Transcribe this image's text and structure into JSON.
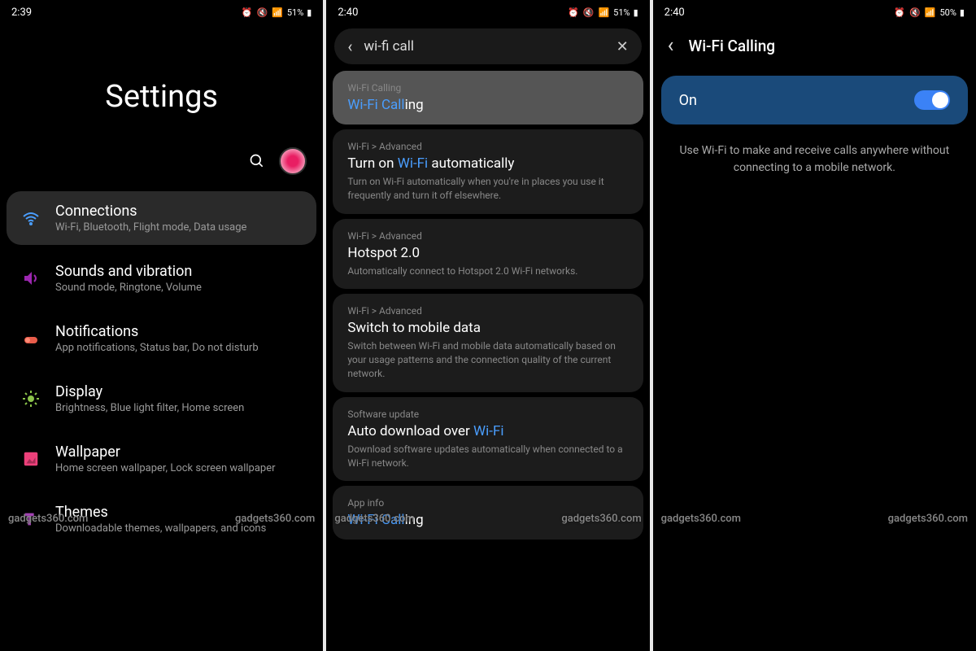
{
  "watermark": "gadgets360.com",
  "screens": [
    {
      "statusbar": {
        "time": "2:39",
        "battery": "51%"
      },
      "hero_title": "Settings",
      "items": [
        {
          "title": "Connections",
          "sub": "Wi-Fi, Bluetooth, Flight mode, Data usage",
          "icon": "wifi",
          "color": "#4a9eff"
        },
        {
          "title": "Sounds and vibration",
          "sub": "Sound mode, Ringtone, Volume",
          "icon": "sound",
          "color": "#9c27b0"
        },
        {
          "title": "Notifications",
          "sub": "App notifications, Status bar, Do not disturb",
          "icon": "notif",
          "color": "#e85c4a"
        },
        {
          "title": "Display",
          "sub": "Brightness, Blue light filter, Home screen",
          "icon": "display",
          "color": "#8bc34a"
        },
        {
          "title": "Wallpaper",
          "sub": "Home screen wallpaper, Lock screen wallpaper",
          "icon": "wallpaper",
          "color": "#ec407a"
        },
        {
          "title": "Themes",
          "sub": "Downloadable themes, wallpapers, and icons",
          "icon": "themes",
          "color": "#ab47bc"
        }
      ]
    },
    {
      "statusbar": {
        "time": "2:40",
        "battery": "51%"
      },
      "search_query": "wi-fi call",
      "results": [
        {
          "crumb": "Wi-Fi Calling",
          "title_pre": "",
          "title_hl": "Wi-Fi Call",
          "title_post": "ing",
          "desc": ""
        },
        {
          "crumb": "Wi-Fi > Advanced",
          "title_pre": "Turn on ",
          "title_hl": "Wi-Fi",
          "title_post": " automatically",
          "desc": "Turn on Wi-Fi automatically when you're in places you use it frequently and turn it off elsewhere."
        },
        {
          "crumb": "Wi-Fi > Advanced",
          "title_pre": "Hotspot 2.0",
          "title_hl": "",
          "title_post": "",
          "desc": "Automatically connect to Hotspot 2.0 Wi-Fi networks."
        },
        {
          "crumb": "Wi-Fi > Advanced",
          "title_pre": "Switch to mobile data",
          "title_hl": "",
          "title_post": "",
          "desc": "Switch between Wi-Fi and mobile data automatically based on your usage patterns and the connection quality of the current network."
        },
        {
          "crumb": "Software update",
          "title_pre": "Auto download over ",
          "title_hl": "Wi-Fi",
          "title_post": "",
          "desc": "Download software updates automatically when connected to a Wi-Fi network."
        },
        {
          "crumb": "App info",
          "title_pre": "",
          "title_hl": "Wi-Fi Call",
          "title_post": "ing",
          "desc": ""
        }
      ]
    },
    {
      "statusbar": {
        "time": "2:40",
        "battery": "50%"
      },
      "page_title": "Wi-Fi Calling",
      "toggle_label": "On",
      "description": "Use Wi-Fi to make and receive calls anywhere without connecting to a mobile network."
    }
  ]
}
